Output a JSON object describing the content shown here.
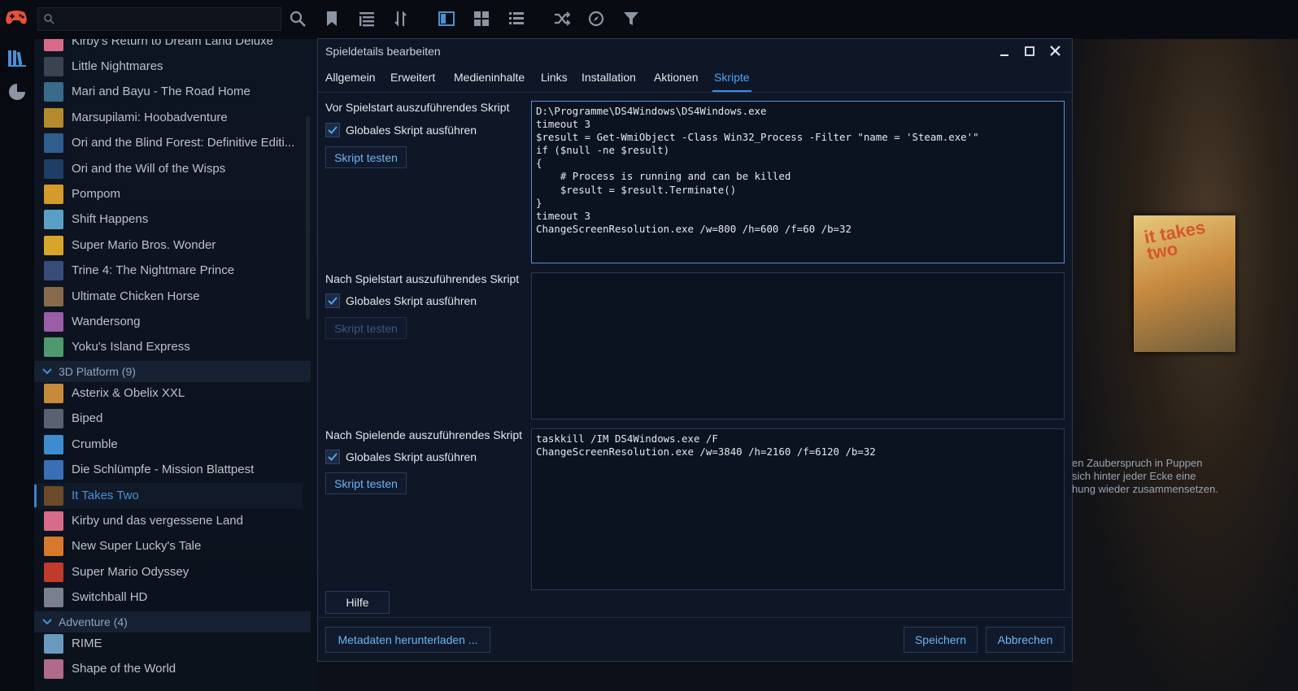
{
  "app": {
    "search": {
      "value": "",
      "placeholder": ""
    },
    "toolbar_icons": [
      "search-icon",
      "bookmark-icon",
      "list-tree-icon",
      "sort-icon",
      "details-view-icon",
      "grid-view-icon",
      "list-view-icon",
      "random-icon",
      "explore-icon",
      "filter-icon"
    ],
    "rail_icons": [
      "library-icon",
      "statistics-icon"
    ]
  },
  "library": {
    "top_partial": "Kirby's Return to Dream Land Deluxe",
    "items_group0": [
      {
        "name": "Little Nightmares",
        "color": "#3b4250"
      },
      {
        "name": "Mari and Bayu - The Road Home",
        "color": "#3a6b8a"
      },
      {
        "name": "Marsupilami: Hoobadventure",
        "color": "#b58a2a"
      },
      {
        "name": "Ori and the Blind Forest: Definitive Editi...",
        "color": "#2f5d8c"
      },
      {
        "name": "Ori and the Will of the Wisps",
        "color": "#1e3e66"
      },
      {
        "name": "Pompom",
        "color": "#d49a2c"
      },
      {
        "name": "Shift Happens",
        "color": "#5aa0c6"
      },
      {
        "name": "Super Mario Bros. Wonder",
        "color": "#d8a52c"
      },
      {
        "name": "Trine 4: The Nightmare Prince",
        "color": "#384c7a"
      },
      {
        "name": "Ultimate Chicken Horse",
        "color": "#8a6a4c"
      },
      {
        "name": "Wandersong",
        "color": "#9a5da8"
      },
      {
        "name": "Yoku's Island Express",
        "color": "#4e9a6e"
      }
    ],
    "group1": {
      "label": "3D Platform (9)"
    },
    "items_group1": [
      {
        "name": "Asterix & Obelix XXL",
        "color": "#c78a3a"
      },
      {
        "name": "Biped",
        "color": "#5a6170"
      },
      {
        "name": "Crumble",
        "color": "#3e8ccf"
      },
      {
        "name": "Die Schlümpfe - Mission Blattpest",
        "color": "#3a6fb8"
      },
      {
        "name": "It Takes Two",
        "color": "#6b4a2a",
        "selected": true
      },
      {
        "name": "Kirby und das vergessene Land",
        "color": "#d86a8a"
      },
      {
        "name": "New Super Lucky's Tale",
        "color": "#d8782c"
      },
      {
        "name": "Super Mario Odyssey",
        "color": "#c23a2c"
      },
      {
        "name": "Switchball HD",
        "color": "#7a8090"
      }
    ],
    "group2": {
      "label": "Adventure (4)"
    },
    "items_group2": [
      {
        "name": "RIME",
        "color": "#6a9ac0"
      },
      {
        "name": "Shape of the World",
        "color": "#b06a8a"
      }
    ]
  },
  "detail": {
    "cover_text": "it takes two",
    "description_lines": [
      "en Zauberspruch in Puppen",
      "sich hinter jeder Ecke eine",
      "hung wieder zusammensetzen."
    ]
  },
  "dialog": {
    "title": "Spieldetails bearbeiten",
    "tabs": [
      "Allgemein",
      "Erweitert",
      "Medieninhalte",
      "Links",
      "Installation",
      "Aktionen",
      "Skripte"
    ],
    "active_tab": "Skripte",
    "sections": [
      {
        "label": "Vor Spielstart auszuführendes Skript",
        "checkbox_label": "Globales Skript ausführen",
        "checked": true,
        "test_button": "Skript testen",
        "test_enabled": true,
        "script": "D:\\Programme\\DS4Windows\\DS4Windows.exe\ntimeout 3\n$result = Get-WmiObject -Class Win32_Process -Filter \"name = 'Steam.exe'\"\nif ($null -ne $result)\n{\n    # Process is running and can be killed\n    $result = $result.Terminate()\n}\ntimeout 3\nChangeScreenResolution.exe /w=800 /h=600 /f=60 /b=32"
      },
      {
        "label": "Nach Spielstart auszuführendes Skript",
        "checkbox_label": "Globales Skript ausführen",
        "checked": true,
        "test_button": "Skript testen",
        "test_enabled": false,
        "script": ""
      },
      {
        "label": "Nach Spielende auszuführendes Skript",
        "checkbox_label": "Globales Skript ausführen",
        "checked": true,
        "test_button": "Skript testen",
        "test_enabled": true,
        "script": "taskkill /IM DS4Windows.exe /F\nChangeScreenResolution.exe /w=3840 /h=2160 /f=6120 /b=32"
      }
    ],
    "help_button": "Hilfe",
    "download_button": "Metadaten herunterladen ...",
    "save_button": "Speichern",
    "cancel_button": "Abbrechen"
  }
}
